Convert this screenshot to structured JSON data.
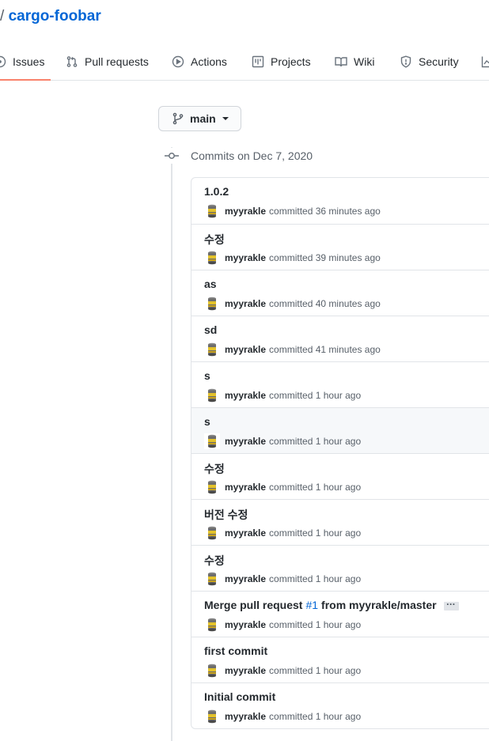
{
  "repo": {
    "separator": "/",
    "name": "cargo-foobar"
  },
  "tabs": {
    "issues": "Issues",
    "pulls": "Pull requests",
    "actions": "Actions",
    "projects": "Projects",
    "wiki": "Wiki",
    "security": "Security"
  },
  "branch": {
    "label": "main"
  },
  "commits_header": "Commits on Dec 7, 2020",
  "commits": [
    {
      "title": "1.0.2",
      "author": "myyrakle",
      "verb": "committed",
      "time": "36 minutes ago"
    },
    {
      "title": "수정",
      "author": "myyrakle",
      "verb": "committed",
      "time": "39 minutes ago"
    },
    {
      "title": "as",
      "author": "myyrakle",
      "verb": "committed",
      "time": "40 minutes ago"
    },
    {
      "title": "sd",
      "author": "myyrakle",
      "verb": "committed",
      "time": "41 minutes ago"
    },
    {
      "title": "s",
      "author": "myyrakle",
      "verb": "committed",
      "time": "1 hour ago"
    },
    {
      "title": "s",
      "author": "myyrakle",
      "verb": "committed",
      "time": "1 hour ago"
    },
    {
      "title": "수정",
      "author": "myyrakle",
      "verb": "committed",
      "time": "1 hour ago"
    },
    {
      "title": "버전 수정",
      "author": "myyrakle",
      "verb": "committed",
      "time": "1 hour ago"
    },
    {
      "title": "수정",
      "author": "myyrakle",
      "verb": "committed",
      "time": "1 hour ago"
    },
    {
      "title_prefix": "Merge pull request",
      "pr_number": "#1",
      "title_suffix": "from myyrakle/master",
      "author": "myyrakle",
      "verb": "committed",
      "time": "1 hour ago"
    },
    {
      "title": "first commit",
      "author": "myyrakle",
      "verb": "committed",
      "time": "1 hour ago"
    },
    {
      "title": "Initial commit",
      "author": "myyrakle",
      "verb": "committed",
      "time": "1 hour ago"
    }
  ]
}
